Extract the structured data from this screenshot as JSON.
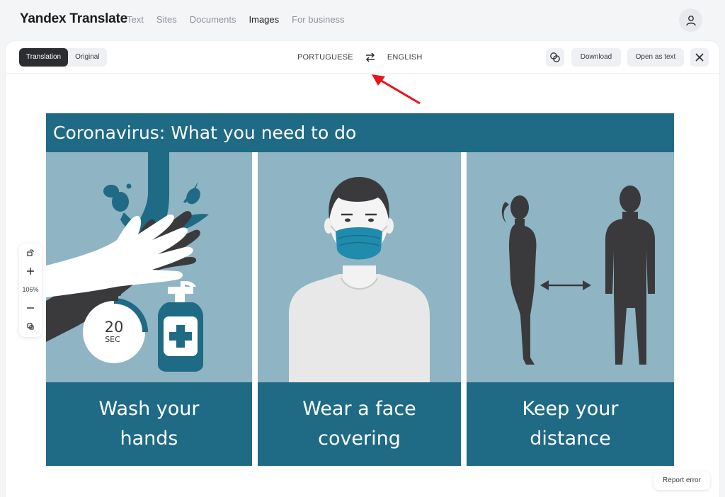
{
  "app": {
    "logo": "Yandex Translate"
  },
  "nav": {
    "items": [
      {
        "label": "Text"
      },
      {
        "label": "Sites"
      },
      {
        "label": "Documents"
      },
      {
        "label": "Images"
      },
      {
        "label": "For business"
      }
    ],
    "active": "Images"
  },
  "toolbar": {
    "view_translation": "Translation",
    "view_original": "Original",
    "source_lang": "PORTUGUESE",
    "target_lang": "ENGLISH",
    "download_label": "Download",
    "open_as_text_label": "Open as text"
  },
  "zoom": {
    "level": "106%"
  },
  "poster": {
    "title": "Coronavirus: What you need to do",
    "timer_number": "20",
    "timer_unit": "SEC",
    "panels": [
      {
        "line1": "Wash your",
        "line2": "hands"
      },
      {
        "line1": "Wear a face",
        "line2": "covering"
      },
      {
        "line1": "Keep your",
        "line2": "distance"
      }
    ]
  },
  "footer": {
    "report_label": "Report error"
  },
  "colors": {
    "poster_dark": "#1f6a84",
    "poster_light": "#8fb4c3",
    "annotation": "#e8141b"
  }
}
